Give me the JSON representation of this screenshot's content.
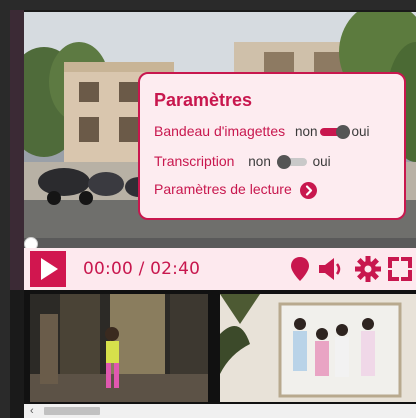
{
  "player": {
    "time_display": "00:00 / 02:40",
    "progress_fraction": 0.0
  },
  "settings": {
    "title": "Paramètres",
    "thumbnail_strip": {
      "label": "Bandeau d'imagettes",
      "off_label": "non",
      "on_label": "oui",
      "enabled": true
    },
    "transcription": {
      "label": "Transcription",
      "off_label": "non",
      "on_label": "oui",
      "enabled": false
    },
    "playback": {
      "label": "Paramètres de lecture"
    }
  },
  "controls": {
    "icons": [
      "location-pin-icon",
      "volume-icon",
      "gear-icon",
      "fullscreen-icon"
    ]
  },
  "thumbnails": [
    {
      "name": "thumbnail-girl-walking"
    },
    {
      "name": "thumbnail-family-photo"
    }
  ],
  "colors": {
    "accent": "#c8174e",
    "panel_bg": "#fdecf0",
    "control_bar_bg": "#fde9ee"
  }
}
